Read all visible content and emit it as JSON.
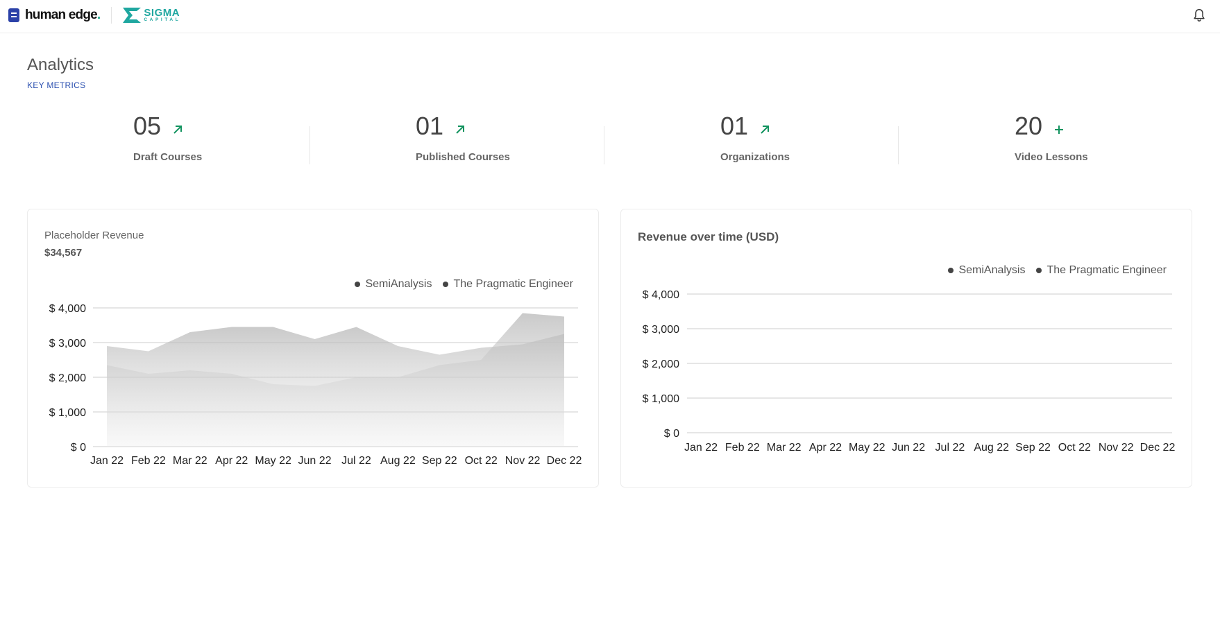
{
  "header": {
    "brand_name": "human edge",
    "brand_dot": ".",
    "partner_name": "SIGMA",
    "partner_sub": "CAPITAL",
    "bell_icon": "bell-icon"
  },
  "page": {
    "title": "Analytics",
    "subtitle": "KEY METRICS"
  },
  "metrics": [
    {
      "value": "05",
      "label": "Draft Courses",
      "icon": "arrow-up-right-icon"
    },
    {
      "value": "01",
      "label": "Published Courses",
      "icon": "arrow-up-right-icon"
    },
    {
      "value": "01",
      "label": "Organizations",
      "icon": "arrow-up-right-icon"
    },
    {
      "value": "20",
      "label": "Video Lessons",
      "icon": "plus-icon"
    }
  ],
  "colors": {
    "accent_green": "#12935f",
    "brand_blue": "#2b41a8",
    "partner_teal": "#1fa7a0"
  },
  "chart_data": [
    {
      "type": "area",
      "title": "Placeholder Revenue",
      "amount": "$34,567",
      "categories": [
        "Jan 22",
        "Feb 22",
        "Mar 22",
        "Apr 22",
        "May 22",
        "Jun 22",
        "Jul 22",
        "Aug 22",
        "Sep 22",
        "Oct 22",
        "Nov 22",
        "Dec 22"
      ],
      "y_ticks": [
        "$ 0",
        "$ 1,000",
        "$ 2,000",
        "$ 3,000",
        "$ 4,000"
      ],
      "ylim": [
        0,
        4000
      ],
      "grid": true,
      "legend_position": "top-right",
      "series": [
        {
          "name": "SemiAnalysis",
          "values": [
            2900,
            2750,
            3300,
            3450,
            3450,
            3100,
            3450,
            2900,
            2650,
            2850,
            2950,
            3250
          ]
        },
        {
          "name": "The Pragmatic Engineer",
          "values": [
            2350,
            2100,
            2200,
            2100,
            1800,
            1750,
            2000,
            2000,
            2350,
            2500,
            3850,
            3750
          ]
        }
      ]
    },
    {
      "type": "line",
      "title": "Revenue over time (USD)",
      "categories": [
        "Jan 22",
        "Feb 22",
        "Mar 22",
        "Apr 22",
        "May 22",
        "Jun 22",
        "Jul 22",
        "Aug 22",
        "Sep 22",
        "Oct 22",
        "Nov 22",
        "Dec 22"
      ],
      "y_ticks": [
        "$ 0",
        "$ 1,000",
        "$ 2,000",
        "$ 3,000",
        "$ 4,000"
      ],
      "ylim": [
        0,
        4000
      ],
      "grid": true,
      "legend_position": "top-right",
      "series": [
        {
          "name": "SemiAnalysis",
          "values": []
        },
        {
          "name": "The Pragmatic Engineer",
          "values": []
        }
      ]
    }
  ]
}
